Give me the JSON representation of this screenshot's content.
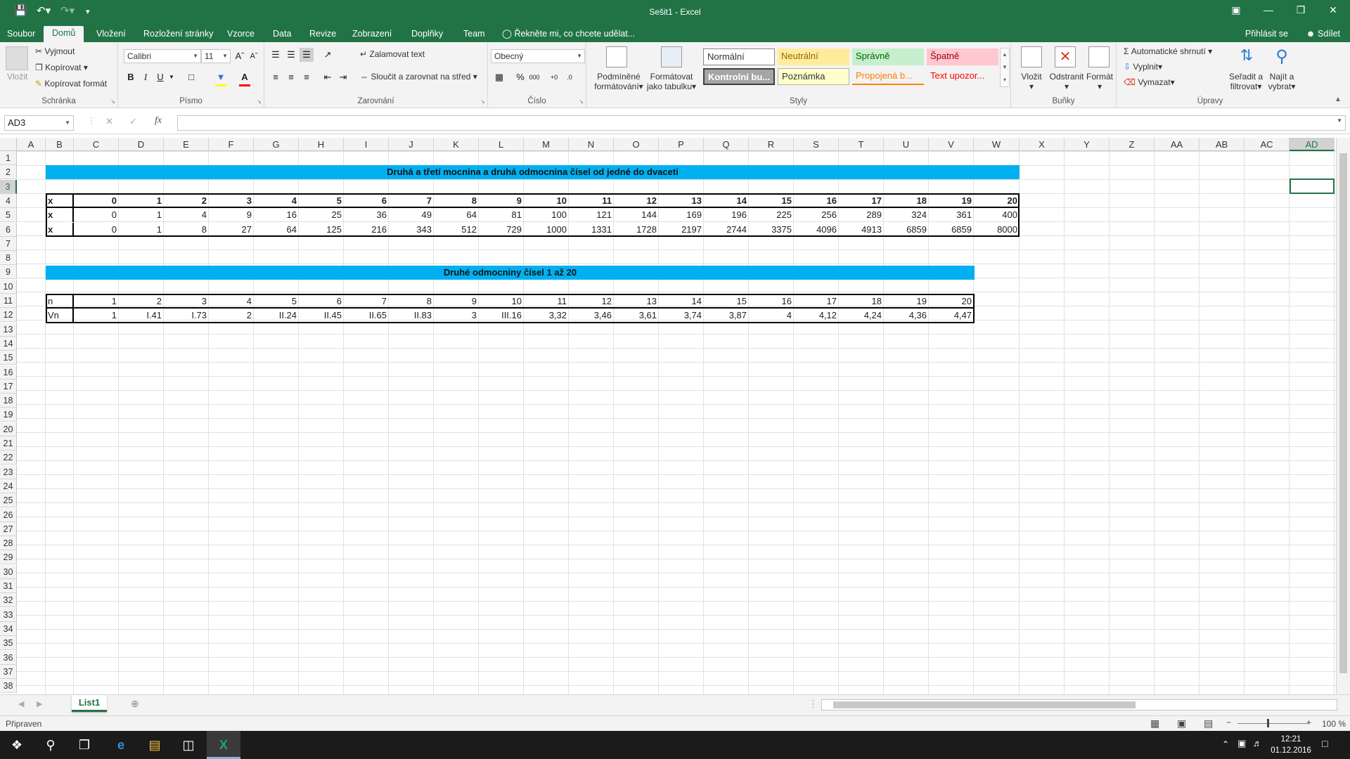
{
  "window": {
    "title": "Sešit1 - Excel"
  },
  "tabs": [
    "Soubor",
    "Domů",
    "Vložení",
    "Rozložení stránky",
    "Vzorce",
    "Data",
    "Revize",
    "Zobrazení",
    "Doplňky",
    "Team"
  ],
  "tell_me": "Řekněte mi, co chcete udělat...",
  "sign_in": "Přihlásit se",
  "share": "Sdílet",
  "ribbon": {
    "clipboard": {
      "paste": "Vložit",
      "cut": "Vyjmout",
      "copy": "Kopírovat",
      "format_painter": "Kopírovat formát",
      "label": "Schránka"
    },
    "font": {
      "name": "Calibri",
      "size": "11",
      "label": "Písmo"
    },
    "alignment": {
      "wrap": "Zalamovat text",
      "merge": "Sloučit a zarovnat na střed",
      "label": "Zarovnání"
    },
    "number": {
      "format": "Obecný",
      "label": "Číslo"
    },
    "styles": {
      "conditional": "Podmíněné",
      "conditional2": "formátování",
      "as_table": "Formátovat",
      "as_table2": "jako tabulku",
      "items": [
        "Normální",
        "Neutrální",
        "Správně",
        "Špatně",
        "Kontrolní bu...",
        "Poznámka",
        "Propojená b...",
        "Text upozor..."
      ],
      "label": "Styly"
    },
    "cells": {
      "insert": "Vložit",
      "delete": "Odstranit",
      "format": "Formát",
      "label": "Buňky"
    },
    "editing": {
      "autosum": "Automatické shrnutí",
      "fill": "Vyplnit",
      "clear": "Vymazat",
      "sort": "Seřadit a",
      "sort2": "filtrovat",
      "find": "Najít a",
      "find2": "vybrat",
      "label": "Úpravy"
    }
  },
  "name_box": "AD3",
  "columns": [
    "A",
    "B",
    "C",
    "D",
    "E",
    "F",
    "G",
    "H",
    "I",
    "J",
    "K",
    "L",
    "M",
    "N",
    "O",
    "P",
    "Q",
    "R",
    "S",
    "T",
    "U",
    "V",
    "W",
    "X",
    "Y",
    "Z",
    "AA",
    "AB",
    "AC",
    "AD"
  ],
  "rows": [
    "1",
    "2",
    "3",
    "4",
    "5",
    "6",
    "7",
    "8",
    "9",
    "10",
    "11",
    "12",
    "13",
    "14",
    "15",
    "16",
    "17",
    "18",
    "19",
    "20",
    "21",
    "22",
    "23",
    "24",
    "25",
    "26",
    "27",
    "28",
    "29",
    "30",
    "31",
    "32",
    "33",
    "34",
    "35",
    "36",
    "37",
    "38"
  ],
  "sheet": {
    "banner1": "Druhá a třetí mocnina a druhá odmocnina čísel od jedné do dvaceti",
    "table1": [
      [
        "x",
        "0",
        "1",
        "2",
        "3",
        "4",
        "5",
        "6",
        "7",
        "8",
        "9",
        "10",
        "11",
        "12",
        "13",
        "14",
        "15",
        "16",
        "17",
        "18",
        "19",
        "20"
      ],
      [
        "x",
        "0",
        "1",
        "4",
        "9",
        "16",
        "25",
        "36",
        "49",
        "64",
        "81",
        "100",
        "121",
        "144",
        "169",
        "196",
        "225",
        "256",
        "289",
        "324",
        "361",
        "400"
      ],
      [
        "x",
        "0",
        "1",
        "8",
        "27",
        "64",
        "125",
        "216",
        "343",
        "512",
        "729",
        "1000",
        "1331",
        "1728",
        "2197",
        "2744",
        "3375",
        "4096",
        "4913",
        "6859",
        "6859",
        "8000"
      ]
    ],
    "banner2": "Druhé odmocniny čísel 1 až 20",
    "table2": [
      [
        "n",
        "1",
        "2",
        "3",
        "4",
        "5",
        "6",
        "7",
        "8",
        "9",
        "10",
        "11",
        "12",
        "13",
        "14",
        "15",
        "16",
        "17",
        "18",
        "19",
        "20"
      ],
      [
        "Vn",
        "1",
        "I.41",
        "I.73",
        "2",
        "II.24",
        "II.45",
        "II.65",
        "II.83",
        "3",
        "III.16",
        "3,32",
        "3,46",
        "3,61",
        "3,74",
        "3,87",
        "4",
        "4,12",
        "4,24",
        "4,36",
        "4,47"
      ]
    ]
  },
  "sheet_tab": "List1",
  "status": {
    "ready": "Připraven",
    "zoom": "100 %"
  },
  "clock": {
    "time": "12:21",
    "date": "01.12.2016"
  }
}
